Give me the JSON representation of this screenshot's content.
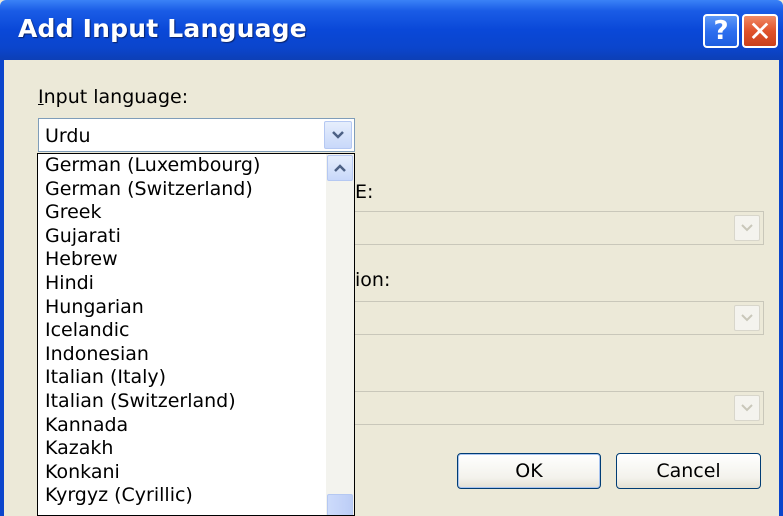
{
  "window": {
    "title": "Add Input Language",
    "help_glyph": "?",
    "close_glyph": "✕"
  },
  "input_language": {
    "label": "Input language:",
    "label_accel": "I",
    "label_rest": "nput language:",
    "selected": "Urdu"
  },
  "hidden_labels": {
    "label_2_fragment": "E:",
    "label_3_fragment": "ion:"
  },
  "dropdown": {
    "items": [
      "German (Luxembourg)",
      "German (Switzerland)",
      "Greek",
      "Gujarati",
      "Hebrew",
      "Hindi",
      "Hungarian",
      "Icelandic",
      "Indonesian",
      "Italian (Italy)",
      "Italian (Switzerland)",
      "Kannada",
      "Kazakh",
      "Konkani",
      "Kyrgyz (Cyrillic)"
    ]
  },
  "buttons": {
    "ok": "OK",
    "cancel": "Cancel"
  },
  "colors": {
    "titlebar": "#0b45cc",
    "dialog_bg": "#ece9d8",
    "close_button": "#e0532c"
  }
}
